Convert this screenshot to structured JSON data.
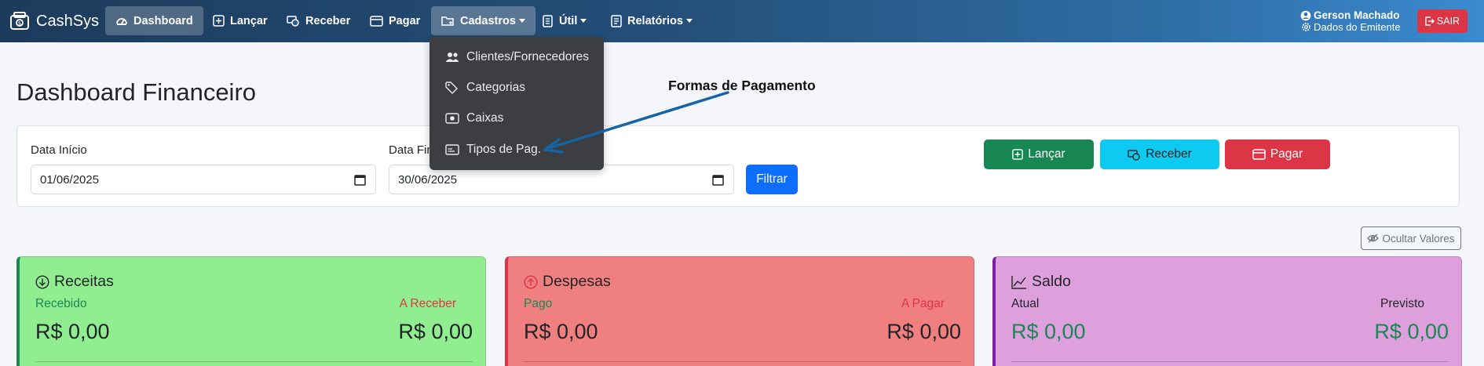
{
  "brand": {
    "name": "CashSys"
  },
  "nav": {
    "dashboard": "Dashboard",
    "lancar": "Lançar",
    "receber": "Receber",
    "pagar": "Pagar",
    "cadastros": "Cadastros",
    "util": "Útil",
    "relatorios": "Relatórios"
  },
  "user": {
    "name": "Gerson Machado",
    "subtitle": "Dados do Emitente",
    "logout": "SAIR"
  },
  "dropdown": {
    "items": [
      "Clientes/Fornecedores",
      "Categorias",
      "Caixas",
      "Tipos de Pag."
    ]
  },
  "annotation": {
    "text": "Formas de Pagamento"
  },
  "page": {
    "title": "Dashboard Financeiro"
  },
  "filter": {
    "start_label": "Data Início",
    "start_value": "01/06/2025",
    "end_label": "Data Fim",
    "end_value": "30/06/2025",
    "filter_button": "Filtrar"
  },
  "actions": {
    "lancar": "Lançar",
    "receber": "Receber",
    "pagar": "Pagar"
  },
  "toggle": {
    "label": "Ocultar Valores"
  },
  "cards": {
    "receitas": {
      "title": "Receitas",
      "left_label": "Recebido",
      "left_value": "R$ 0,00",
      "right_label": "A Receber",
      "right_value": "R$ 0,00"
    },
    "despesas": {
      "title": "Despesas",
      "left_label": "Pago",
      "left_value": "R$ 0,00",
      "right_label": "A Pagar",
      "right_value": "R$ 0,00"
    },
    "saldo": {
      "title": "Saldo",
      "left_label": "Atual",
      "left_value": "R$ 0,00",
      "right_label": "Previsto",
      "right_value": "R$ 0,00"
    }
  },
  "colors": {
    "navbar_start": "#1d3b5c",
    "navbar_end": "#3b8ad0",
    "success": "#198754",
    "info": "#0dcaf0",
    "danger": "#dc3545",
    "primary": "#0d6efd",
    "receitas_bg": "#90ee90",
    "despesas_bg": "#f08080",
    "saldo_bg": "#dda0dd"
  }
}
